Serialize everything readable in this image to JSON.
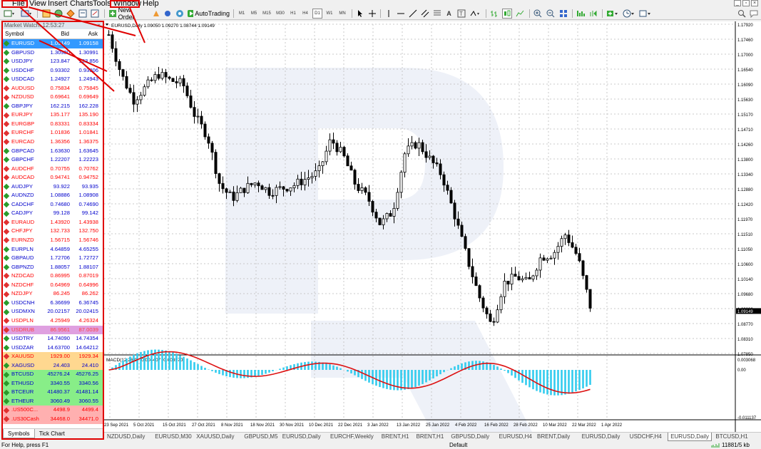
{
  "menu": [
    "File",
    "View",
    "Insert",
    "Charts",
    "Tools",
    "Window",
    "Help"
  ],
  "toolbar": {
    "new_order": "New Order",
    "autotrading": "AutoTrading",
    "timeframes": [
      "M1",
      "M5",
      "M15",
      "M30",
      "H1",
      "H4",
      "D1",
      "W1",
      "MN"
    ]
  },
  "market_watch": {
    "title": "Market Watch: 12:53:27",
    "col_symbol": "Symbol",
    "col_bid": "Bid",
    "col_ask": "Ask",
    "rows": [
      {
        "s": "EURUSD",
        "b": "1.09149",
        "a": "1.09158",
        "bg": "#3399ff",
        "fg": "#ffffff"
      },
      {
        "s": "GBPUSD",
        "b": "1.30980",
        "a": "1.30991",
        "fg": "#0000cc"
      },
      {
        "s": "USDJPY",
        "b": "123.847",
        "a": "123.856",
        "fg": "#0000cc"
      },
      {
        "s": "USDCHF",
        "b": "0.93302",
        "a": "0.93306",
        "fg": "#0000cc"
      },
      {
        "s": "USDCAD",
        "b": "1.24927",
        "a": "1.24943",
        "fg": "#0000cc"
      },
      {
        "s": "AUDUSD",
        "b": "0.75834",
        "a": "0.75845",
        "fg": "#ff0000"
      },
      {
        "s": "NZDUSD",
        "b": "0.69641",
        "a": "0.69649",
        "fg": "#ff0000"
      },
      {
        "s": "GBPJPY",
        "b": "162.215",
        "a": "162.228",
        "fg": "#0000cc"
      },
      {
        "s": "EURJPY",
        "b": "135.177",
        "a": "135.190",
        "fg": "#ff0000"
      },
      {
        "s": "EURGBP",
        "b": "0.83331",
        "a": "0.83334",
        "fg": "#ff0000"
      },
      {
        "s": "EURCHF",
        "b": "1.01836",
        "a": "1.01841",
        "fg": "#ff0000"
      },
      {
        "s": "EURCAD",
        "b": "1.36356",
        "a": "1.36375",
        "fg": "#ff0000"
      },
      {
        "s": "GBPCAD",
        "b": "1.63630",
        "a": "1.63645",
        "fg": "#0000cc"
      },
      {
        "s": "GBPCHF",
        "b": "1.22207",
        "a": "1.22223",
        "fg": "#0000cc"
      },
      {
        "s": "AUDCHF",
        "b": "0.70755",
        "a": "0.70762",
        "fg": "#ff0000"
      },
      {
        "s": "AUDCAD",
        "b": "0.94741",
        "a": "0.94752",
        "fg": "#ff0000"
      },
      {
        "s": "AUDJPY",
        "b": "93.922",
        "a": "93.935",
        "fg": "#0000cc"
      },
      {
        "s": "AUDNZD",
        "b": "1.08886",
        "a": "1.08908",
        "fg": "#0000cc"
      },
      {
        "s": "CADCHF",
        "b": "0.74680",
        "a": "0.74690",
        "fg": "#0000cc"
      },
      {
        "s": "CADJPY",
        "b": "99.128",
        "a": "99.142",
        "fg": "#0000cc"
      },
      {
        "s": "EURAUD",
        "b": "1.43920",
        "a": "1.43938",
        "fg": "#ff0000"
      },
      {
        "s": "CHFJPY",
        "b": "132.733",
        "a": "132.750",
        "fg": "#ff0000"
      },
      {
        "s": "EURNZD",
        "b": "1.56715",
        "a": "1.56746",
        "fg": "#ff0000"
      },
      {
        "s": "EURPLN",
        "b": "4.64859",
        "a": "4.65255",
        "fg": "#0000cc"
      },
      {
        "s": "GBPAUD",
        "b": "1.72706",
        "a": "1.72727",
        "fg": "#0000cc"
      },
      {
        "s": "GBPNZD",
        "b": "1.88057",
        "a": "1.88107",
        "fg": "#0000cc"
      },
      {
        "s": "NZDCAD",
        "b": "0.86995",
        "a": "0.87019",
        "fg": "#ff0000"
      },
      {
        "s": "NZDCHF",
        "b": "0.64969",
        "a": "0.64996",
        "fg": "#ff0000"
      },
      {
        "s": "NZDJPY",
        "b": "86.245",
        "a": "86.262",
        "fg": "#ff0000"
      },
      {
        "s": "USDCNH",
        "b": "6.36699",
        "a": "6.36745",
        "fg": "#0000cc"
      },
      {
        "s": "USDMXN",
        "b": "20.02157",
        "a": "20.02415",
        "fg": "#0000cc"
      },
      {
        "s": "USDPLN",
        "b": "4.25949",
        "a": "4.26324",
        "fg": "#ff0000"
      },
      {
        "s": "USDRUB",
        "b": "86.9561",
        "a": "87.0039",
        "bg": "#dfa0e0",
        "fg": "#ff4040"
      },
      {
        "s": "USDTRY",
        "b": "14.74090",
        "a": "14.74354",
        "fg": "#0000cc"
      },
      {
        "s": "USDZAR",
        "b": "14.63700",
        "a": "14.64212",
        "fg": "#0000cc"
      },
      {
        "s": "XAUUSD",
        "b": "1929.00",
        "a": "1929.34",
        "bg": "#ffd890",
        "fg": "#ff0000"
      },
      {
        "s": "XAGUSD",
        "b": "24.403",
        "a": "24.410",
        "bg": "#ffd890",
        "fg": "#0000cc"
      },
      {
        "s": "BTCUSD",
        "b": "45276.24",
        "a": "45276.25",
        "bg": "#88ee88",
        "fg": "#0000cc"
      },
      {
        "s": "ETHUSD",
        "b": "3340.55",
        "a": "3340.56",
        "bg": "#88ee88",
        "fg": "#0000cc"
      },
      {
        "s": "BTCEUR",
        "b": "41480.37",
        "a": "41481.14",
        "bg": "#88ee88",
        "fg": "#0000cc"
      },
      {
        "s": "ETHEUR",
        "b": "3060.49",
        "a": "3060.55",
        "bg": "#88ee88",
        "fg": "#0000cc"
      },
      {
        "s": ".US500C...",
        "b": "4498.9",
        "a": "4499.4",
        "bg": "#ffb0b0",
        "fg": "#ff0000"
      },
      {
        "s": ".US30Cash",
        "b": "34468.0",
        "a": "34471.0",
        "bg": "#ffb0b0",
        "fg": "#ff0000"
      }
    ],
    "tabs": [
      "Symbols",
      "Tick Chart"
    ]
  },
  "chart": {
    "header": "EURUSD,Daily  1.09050 1.09270 1.08744 1.09149",
    "macd_header": "MACD(12,26,9) -0.004407 -0.003570",
    "current_price": "1.09149",
    "price_labels": [
      "1.17920",
      "1.17460",
      "1.17000",
      "1.16540",
      "1.16090",
      "1.15630",
      "1.15170",
      "1.14710",
      "1.14260",
      "1.13800",
      "1.13340",
      "1.12880",
      "1.12420",
      "1.11970",
      "1.11510",
      "1.11050",
      "1.10600",
      "1.10140",
      "1.09680",
      "1.09220",
      "1.08770",
      "1.08310",
      "1.07850"
    ],
    "macd_labels": [
      "0.003068",
      "0.00",
      "-0.011137"
    ],
    "date_labels": [
      "23 Sep 2021",
      "5 Oct 2021",
      "15 Oct 2021",
      "27 Oct 2021",
      "8 Nov 2021",
      "18 Nov 2021",
      "30 Nov 2021",
      "10 Dec 2021",
      "22 Dec 2021",
      "3 Jan 2022",
      "13 Jan 2022",
      "25 Jan 2022",
      "4 Feb 2022",
      "16 Feb 2022",
      "28 Feb 2022",
      "10 Mar 2022",
      "22 Mar 2022",
      "1 Apr 2022"
    ]
  },
  "chart_tabs": [
    "NZDUSD,Daily",
    "EURUSD,M30",
    "XAUUSD,Daily",
    "GBPUSD,M5",
    "EURUSD,Daily",
    "EURCHF,Weekly",
    "BRENT,H1",
    "BRENT,H1",
    "GBPUSD,Daily",
    "EURUSD,H4",
    "BRENT,Daily",
    "EURUSD,Daily",
    "USDCHF,H4",
    "EURUSD,Daily",
    "BTCUSD,H1"
  ],
  "status": {
    "help": "For Help, press F1",
    "profile": "Default",
    "traffic": "11881/5 kb"
  },
  "colors": {
    "highlight": "#e00000",
    "macd_hist": "#33ccee",
    "macd_signal": "#dd1111",
    "selected_row": "#3399ff"
  }
}
